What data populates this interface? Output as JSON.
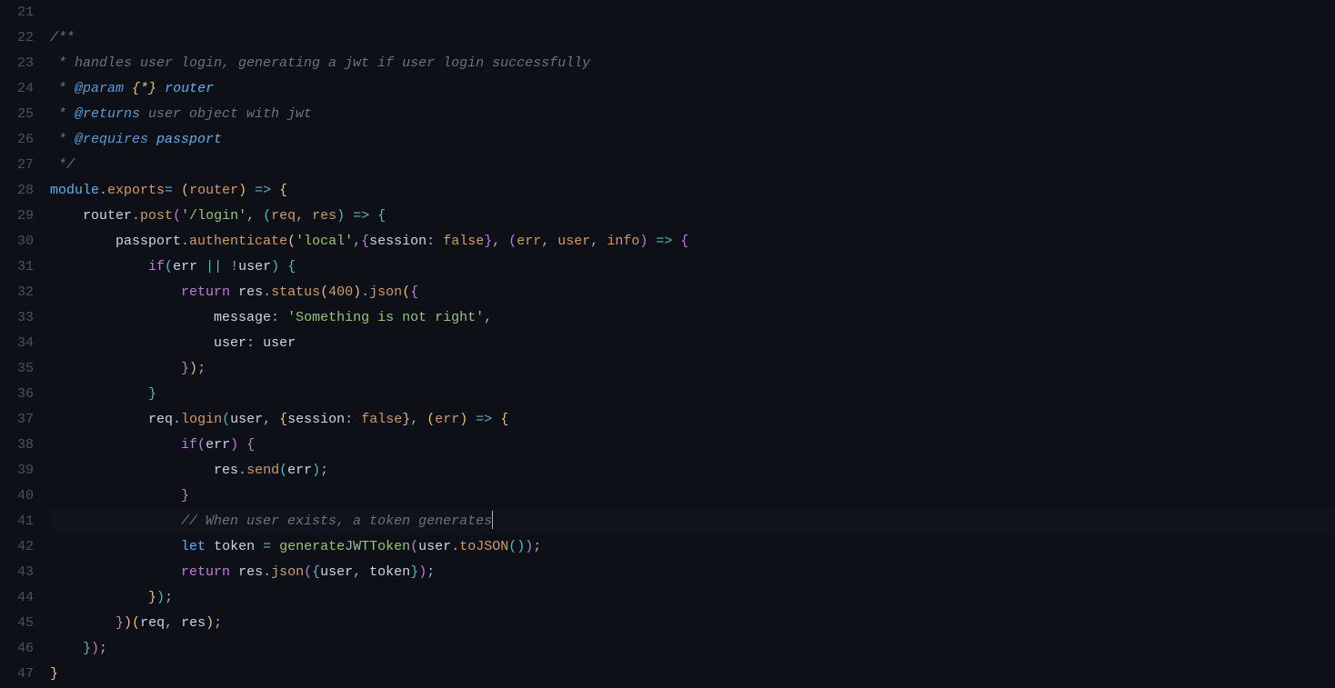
{
  "startLine": 21,
  "endLine": 47,
  "currentLine": 41,
  "lines": [
    {
      "n": 21,
      "tokens": []
    },
    {
      "n": 22,
      "tokens": [
        {
          "t": "/**",
          "c": "comment"
        }
      ]
    },
    {
      "n": 23,
      "tokens": [
        {
          "t": " * handles user login, generating a jwt if user login successfully",
          "c": "comment"
        }
      ]
    },
    {
      "n": 24,
      "tokens": [
        {
          "t": " * ",
          "c": "comment"
        },
        {
          "t": "@param",
          "c": "jsdoc-tag"
        },
        {
          "t": " ",
          "c": "comment"
        },
        {
          "t": "{*}",
          "c": "jsdoc-type"
        },
        {
          "t": " ",
          "c": "comment"
        },
        {
          "t": "router",
          "c": "jsdoc-name"
        }
      ]
    },
    {
      "n": 25,
      "tokens": [
        {
          "t": " * ",
          "c": "comment"
        },
        {
          "t": "@returns",
          "c": "jsdoc-tag"
        },
        {
          "t": " user object with jwt",
          "c": "comment"
        }
      ]
    },
    {
      "n": 26,
      "tokens": [
        {
          "t": " * ",
          "c": "comment"
        },
        {
          "t": "@requires",
          "c": "jsdoc-tag"
        },
        {
          "t": " ",
          "c": "comment"
        },
        {
          "t": "passport",
          "c": "jsdoc-name"
        }
      ]
    },
    {
      "n": 27,
      "tokens": [
        {
          "t": " */",
          "c": "comment"
        }
      ]
    },
    {
      "n": 28,
      "tokens": [
        {
          "t": "module",
          "c": "kw-module"
        },
        {
          "t": ".",
          "c": "punct"
        },
        {
          "t": "exports",
          "c": "kw-exports"
        },
        {
          "t": "=",
          "c": "op"
        },
        {
          "t": " ",
          "c": ""
        },
        {
          "t": "(",
          "c": "brace-y"
        },
        {
          "t": "router",
          "c": "param"
        },
        {
          "t": ")",
          "c": "brace-y"
        },
        {
          "t": " ",
          "c": ""
        },
        {
          "t": "=>",
          "c": "op"
        },
        {
          "t": " ",
          "c": ""
        },
        {
          "t": "{",
          "c": "brace-y"
        }
      ]
    },
    {
      "n": 29,
      "tokens": [
        {
          "t": "    ",
          "c": ""
        },
        {
          "t": "router",
          "c": "ident"
        },
        {
          "t": ".",
          "c": "punct"
        },
        {
          "t": "post",
          "c": "fn-call"
        },
        {
          "t": "(",
          "c": "brace-p"
        },
        {
          "t": "'/login'",
          "c": "string"
        },
        {
          "t": ", ",
          "c": "punct"
        },
        {
          "t": "(",
          "c": "brace-b"
        },
        {
          "t": "req",
          "c": "param"
        },
        {
          "t": ", ",
          "c": "punct"
        },
        {
          "t": "res",
          "c": "param"
        },
        {
          "t": ")",
          "c": "brace-b"
        },
        {
          "t": " ",
          "c": ""
        },
        {
          "t": "=>",
          "c": "op"
        },
        {
          "t": " ",
          "c": ""
        },
        {
          "t": "{",
          "c": "brace-b"
        }
      ]
    },
    {
      "n": 30,
      "tokens": [
        {
          "t": "        ",
          "c": ""
        },
        {
          "t": "passport",
          "c": "ident"
        },
        {
          "t": ".",
          "c": "punct"
        },
        {
          "t": "authenticate",
          "c": "fn-call"
        },
        {
          "t": "(",
          "c": "brace-y"
        },
        {
          "t": "'local'",
          "c": "string"
        },
        {
          "t": ",",
          "c": "punct"
        },
        {
          "t": "{",
          "c": "brace-p"
        },
        {
          "t": "session",
          "c": "ident"
        },
        {
          "t": ":",
          "c": "punct"
        },
        {
          "t": " ",
          "c": ""
        },
        {
          "t": "false",
          "c": "kw-false"
        },
        {
          "t": "}",
          "c": "brace-p"
        },
        {
          "t": ", ",
          "c": "punct"
        },
        {
          "t": "(",
          "c": "brace-p"
        },
        {
          "t": "err",
          "c": "param"
        },
        {
          "t": ", ",
          "c": "punct"
        },
        {
          "t": "user",
          "c": "param"
        },
        {
          "t": ", ",
          "c": "punct"
        },
        {
          "t": "info",
          "c": "param"
        },
        {
          "t": ")",
          "c": "brace-p"
        },
        {
          "t": " ",
          "c": ""
        },
        {
          "t": "=>",
          "c": "op"
        },
        {
          "t": " ",
          "c": ""
        },
        {
          "t": "{",
          "c": "brace-p"
        }
      ]
    },
    {
      "n": 31,
      "tokens": [
        {
          "t": "            ",
          "c": ""
        },
        {
          "t": "if",
          "c": "kw-if"
        },
        {
          "t": "(",
          "c": "brace-b"
        },
        {
          "t": "err",
          "c": "ident"
        },
        {
          "t": " ",
          "c": ""
        },
        {
          "t": "||",
          "c": "op"
        },
        {
          "t": " ",
          "c": ""
        },
        {
          "t": "!",
          "c": "op"
        },
        {
          "t": "user",
          "c": "ident"
        },
        {
          "t": ")",
          "c": "brace-b"
        },
        {
          "t": " ",
          "c": ""
        },
        {
          "t": "{",
          "c": "brace-b"
        }
      ]
    },
    {
      "n": 32,
      "tokens": [
        {
          "t": "                ",
          "c": ""
        },
        {
          "t": "return",
          "c": "kw-return"
        },
        {
          "t": " ",
          "c": ""
        },
        {
          "t": "res",
          "c": "ident"
        },
        {
          "t": ".",
          "c": "punct"
        },
        {
          "t": "status",
          "c": "fn-call"
        },
        {
          "t": "(",
          "c": "brace-y"
        },
        {
          "t": "400",
          "c": "num"
        },
        {
          "t": ")",
          "c": "brace-y"
        },
        {
          "t": ".",
          "c": "punct"
        },
        {
          "t": "json",
          "c": "fn-call"
        },
        {
          "t": "(",
          "c": "brace-y"
        },
        {
          "t": "{",
          "c": "brace-p"
        }
      ]
    },
    {
      "n": 33,
      "tokens": [
        {
          "t": "                    ",
          "c": ""
        },
        {
          "t": "message",
          "c": "ident"
        },
        {
          "t": ":",
          "c": "punct"
        },
        {
          "t": " ",
          "c": ""
        },
        {
          "t": "'Something is not right'",
          "c": "string"
        },
        {
          "t": ",",
          "c": "punct"
        }
      ]
    },
    {
      "n": 34,
      "tokens": [
        {
          "t": "                    ",
          "c": ""
        },
        {
          "t": "user",
          "c": "ident"
        },
        {
          "t": ":",
          "c": "punct"
        },
        {
          "t": " ",
          "c": ""
        },
        {
          "t": "user",
          "c": "ident"
        }
      ]
    },
    {
      "n": 35,
      "tokens": [
        {
          "t": "                ",
          "c": ""
        },
        {
          "t": "}",
          "c": "brace-p"
        },
        {
          "t": ")",
          "c": "brace-y"
        },
        {
          "t": ";",
          "c": "punct"
        }
      ]
    },
    {
      "n": 36,
      "tokens": [
        {
          "t": "            ",
          "c": ""
        },
        {
          "t": "}",
          "c": "brace-b"
        }
      ]
    },
    {
      "n": 37,
      "tokens": [
        {
          "t": "            ",
          "c": ""
        },
        {
          "t": "req",
          "c": "ident"
        },
        {
          "t": ".",
          "c": "punct"
        },
        {
          "t": "login",
          "c": "fn-call"
        },
        {
          "t": "(",
          "c": "brace-b"
        },
        {
          "t": "user",
          "c": "ident"
        },
        {
          "t": ", ",
          "c": "punct"
        },
        {
          "t": "{",
          "c": "brace-y"
        },
        {
          "t": "session",
          "c": "ident"
        },
        {
          "t": ":",
          "c": "punct"
        },
        {
          "t": " ",
          "c": ""
        },
        {
          "t": "false",
          "c": "kw-false"
        },
        {
          "t": "}",
          "c": "brace-y"
        },
        {
          "t": ", ",
          "c": "punct"
        },
        {
          "t": "(",
          "c": "brace-y"
        },
        {
          "t": "err",
          "c": "param"
        },
        {
          "t": ")",
          "c": "brace-y"
        },
        {
          "t": " ",
          "c": ""
        },
        {
          "t": "=>",
          "c": "op"
        },
        {
          "t": " ",
          "c": ""
        },
        {
          "t": "{",
          "c": "brace-y"
        }
      ]
    },
    {
      "n": 38,
      "tokens": [
        {
          "t": "                ",
          "c": ""
        },
        {
          "t": "if",
          "c": "kw-if"
        },
        {
          "t": "(",
          "c": "brace-p"
        },
        {
          "t": "err",
          "c": "ident"
        },
        {
          "t": ")",
          "c": "brace-p"
        },
        {
          "t": " ",
          "c": ""
        },
        {
          "t": "{",
          "c": "brace-p"
        }
      ]
    },
    {
      "n": 39,
      "tokens": [
        {
          "t": "                    ",
          "c": ""
        },
        {
          "t": "res",
          "c": "ident"
        },
        {
          "t": ".",
          "c": "punct"
        },
        {
          "t": "send",
          "c": "fn-call"
        },
        {
          "t": "(",
          "c": "brace-b"
        },
        {
          "t": "err",
          "c": "ident"
        },
        {
          "t": ")",
          "c": "brace-b"
        },
        {
          "t": ";",
          "c": "punct"
        }
      ]
    },
    {
      "n": 40,
      "tokens": [
        {
          "t": "                ",
          "c": ""
        },
        {
          "t": "}",
          "c": "brace-p"
        }
      ]
    },
    {
      "n": 41,
      "tokens": [
        {
          "t": "                ",
          "c": ""
        },
        {
          "t": "// When user exists, a token generates",
          "c": "comment"
        }
      ]
    },
    {
      "n": 42,
      "tokens": [
        {
          "t": "                ",
          "c": ""
        },
        {
          "t": "let",
          "c": "kw-let"
        },
        {
          "t": " ",
          "c": ""
        },
        {
          "t": "token",
          "c": "ident"
        },
        {
          "t": " ",
          "c": ""
        },
        {
          "t": "=",
          "c": "op"
        },
        {
          "t": " ",
          "c": ""
        },
        {
          "t": "generateJWTToken",
          "c": "fn-green"
        },
        {
          "t": "(",
          "c": "brace-p"
        },
        {
          "t": "user",
          "c": "ident"
        },
        {
          "t": ".",
          "c": "punct"
        },
        {
          "t": "toJSON",
          "c": "fn-call"
        },
        {
          "t": "(",
          "c": "brace-b"
        },
        {
          "t": ")",
          "c": "brace-b"
        },
        {
          "t": ")",
          "c": "brace-p"
        },
        {
          "t": ";",
          "c": "punct"
        }
      ]
    },
    {
      "n": 43,
      "tokens": [
        {
          "t": "                ",
          "c": ""
        },
        {
          "t": "return",
          "c": "kw-return"
        },
        {
          "t": " ",
          "c": ""
        },
        {
          "t": "res",
          "c": "ident"
        },
        {
          "t": ".",
          "c": "punct"
        },
        {
          "t": "json",
          "c": "fn-call"
        },
        {
          "t": "(",
          "c": "brace-p"
        },
        {
          "t": "{",
          "c": "brace-b"
        },
        {
          "t": "user",
          "c": "ident"
        },
        {
          "t": ", ",
          "c": "punct"
        },
        {
          "t": "token",
          "c": "ident"
        },
        {
          "t": "}",
          "c": "brace-b"
        },
        {
          "t": ")",
          "c": "brace-p"
        },
        {
          "t": ";",
          "c": "punct"
        }
      ]
    },
    {
      "n": 44,
      "tokens": [
        {
          "t": "            ",
          "c": ""
        },
        {
          "t": "}",
          "c": "brace-y"
        },
        {
          "t": ")",
          "c": "brace-b"
        },
        {
          "t": ";",
          "c": "punct"
        }
      ]
    },
    {
      "n": 45,
      "tokens": [
        {
          "t": "        ",
          "c": ""
        },
        {
          "t": "}",
          "c": "brace-p"
        },
        {
          "t": ")",
          "c": "brace-y"
        },
        {
          "t": "(",
          "c": "brace-y"
        },
        {
          "t": "req",
          "c": "ident"
        },
        {
          "t": ", ",
          "c": "punct"
        },
        {
          "t": "res",
          "c": "ident"
        },
        {
          "t": ")",
          "c": "brace-y"
        },
        {
          "t": ";",
          "c": "punct"
        }
      ]
    },
    {
      "n": 46,
      "tokens": [
        {
          "t": "    ",
          "c": ""
        },
        {
          "t": "}",
          "c": "brace-b"
        },
        {
          "t": ")",
          "c": "brace-p"
        },
        {
          "t": ";",
          "c": "punct"
        }
      ]
    },
    {
      "n": 47,
      "tokens": [
        {
          "t": "}",
          "c": "brace-y"
        }
      ]
    }
  ]
}
